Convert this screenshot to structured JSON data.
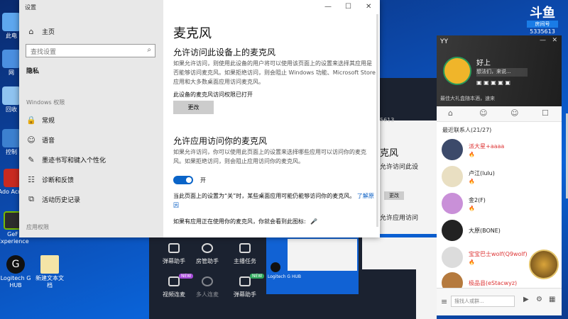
{
  "desktop": {
    "icons": [
      {
        "label": "Adobe Acrobat",
        "icon": "pdf-icon"
      },
      {
        "label": "GeForce Experience",
        "icon": "geforce-icon"
      },
      {
        "label": "Logitech G HUB",
        "icon": "logitech-icon"
      },
      {
        "label": "新建文本文档",
        "icon": "text-file-icon"
      }
    ],
    "left_edge_labels": [
      "此电",
      "网",
      "回收",
      "控制",
      "Ado Acrob",
      "GeF Experience"
    ]
  },
  "settings": {
    "window_title": "设置",
    "controls": [
      "minimize",
      "maximize",
      "close"
    ],
    "sidebar": {
      "home": "主页",
      "search_placeholder": "查找设置",
      "privacy_label": "隐私",
      "section": "Windows 权限",
      "items": [
        {
          "label": "常规",
          "icon": "lock-icon"
        },
        {
          "label": "语音",
          "icon": "speech-icon"
        },
        {
          "label": "墨迹书写和键入个性化",
          "icon": "pen-icon"
        },
        {
          "label": "诊断和反馈",
          "icon": "diagnostics-icon"
        },
        {
          "label": "活动历史记录",
          "icon": "history-icon"
        }
      ],
      "app_section": "应用权限"
    },
    "content": {
      "title": "麦克风",
      "section1_title": "允许访问此设备上的麦克风",
      "section1_desc": "如果允许访问，则使用此设备的用户将可以使用该页面上的设置来选择其应用是否能够访问麦克风。如果拒绝访问，则会阻止 Windows 功能、Microsoft Store 应用和大多数桌面应用访问麦克风。",
      "status": "此设备的麦克风访问权限已打开",
      "change_button": "更改",
      "section2_title": "允许应用访问你的麦克风",
      "section2_desc": "如果允许访问，你可以使用此页面上的设置来选择哪些应用可以访问你的麦克风。如果拒绝访问，则会阻止应用访问你的麦克风。",
      "toggle_state": "开",
      "toggle_on": true,
      "note": "当此页面上的设置为“关”时，某些桌面应用可能仍能够访问你的麦克风。",
      "note_link": "了解原因",
      "footer": "如果有应用正在使用你的麦克风，你就会看到此图标:"
    }
  },
  "douyu": {
    "logo": "斗鱼",
    "sub": "房间号",
    "room_id": "5335613"
  },
  "obs_tools": [
    {
      "label": "弹幕助手"
    },
    {
      "label": "房管助手"
    },
    {
      "label": "主播任务"
    },
    {
      "label": "视频连麦",
      "badge": "NEW"
    },
    {
      "label": "多人连麦"
    },
    {
      "label": "弹幕助手",
      "badge": "NEW"
    }
  ],
  "mirror_labels": {
    "room_fragment": "5613",
    "title": "克风",
    "sub1": "允许访问此设",
    "sub2": "允许应用访问",
    "change": "更改",
    "logitech": "Logitech G HUB"
  },
  "qq": {
    "header": "YY",
    "profile_name": "好上",
    "profile_status": "想法们，来说...",
    "notice": "最佳大礼盒随本酒，速来",
    "group_header": "最近联系人(21/27)",
    "contacts": [
      {
        "name": "派大星+aaaa"
      },
      {
        "name": "卢江(lulu)"
      },
      {
        "name": "金2(F)"
      },
      {
        "name": "大原(BONE)"
      },
      {
        "name": "宝宝巴士wolf(Q9wolf)"
      },
      {
        "name": "极品县(eStacwyz)"
      }
    ],
    "search_placeholder": "搜找人或群..."
  }
}
